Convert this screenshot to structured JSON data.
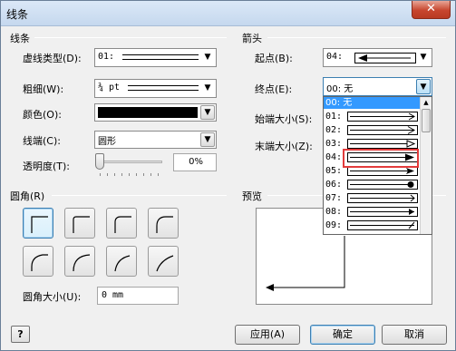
{
  "window": {
    "title": "线条",
    "close_label": "✕"
  },
  "line_section": {
    "title": "线条",
    "dash_type": {
      "label": "虚线类型(D):",
      "value": "01:"
    },
    "weight": {
      "label": "粗细(W):",
      "value": "¾ pt"
    },
    "color": {
      "label": "颜色(O):",
      "value_color": "#000000"
    },
    "cap": {
      "label": "线端(C):",
      "value": "圆形"
    },
    "transparency": {
      "label": "透明度(T):",
      "value": "0%",
      "level": 0
    }
  },
  "arrow_section": {
    "title": "箭头",
    "begin": {
      "label": "起点(B):",
      "value": "04:"
    },
    "end": {
      "label": "终点(E):",
      "value": "00: 无"
    },
    "begin_size_label": "始端大小(S):",
    "end_size_label": "末端大小(Z):"
  },
  "rounding_section": {
    "title": "圆角(R)",
    "size_label": "圆角大小(U):",
    "size_value": "0 mm"
  },
  "preview_section": {
    "title": "预览"
  },
  "dropdown": {
    "items": [
      "00: 无",
      "01:",
      "02:",
      "03:",
      "04:",
      "05:",
      "06:",
      "07:",
      "08:",
      "09:"
    ],
    "highlighted_index": 0,
    "boxed_index": 4
  },
  "buttons": {
    "apply": "应用(A)",
    "ok": "确定",
    "cancel": "取消"
  },
  "icons": {
    "help": "help-icon"
  },
  "colors": {
    "highlight": "#3399ff",
    "annotation": "#e23b3b"
  }
}
